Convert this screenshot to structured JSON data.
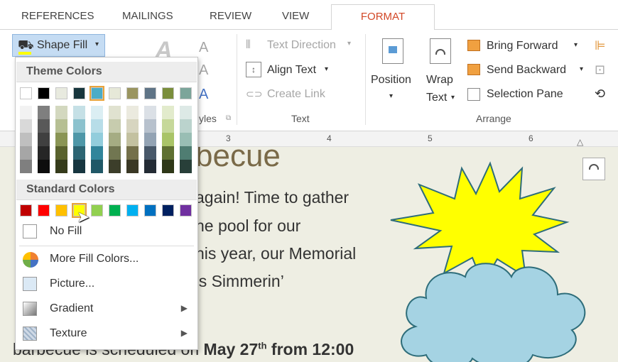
{
  "tabs": {
    "references": "REFERENCES",
    "mailings": "MAILINGS",
    "review": "REVIEW",
    "view": "VIEW",
    "format": "FORMAT"
  },
  "ribbon": {
    "shape_fill": "Shape Fill",
    "text_direction": "Text Direction",
    "align_text": "Align Text",
    "create_link": "Create Link",
    "text_group": "Text",
    "styles_group_partial": "yles",
    "position": "Position",
    "wrap": "Wrap",
    "wrap_text": "Text",
    "bring_forward": "Bring Forward",
    "send_backward": "Send Backward",
    "selection_pane": "Selection Pane",
    "arrange_group": "Arrange"
  },
  "ruler": {
    "marks": [
      "3",
      "4",
      "5",
      "6"
    ]
  },
  "dropdown": {
    "theme_header": "Theme Colors",
    "standard_header": "Standard Colors",
    "theme_top": [
      "#ffffff",
      "#000000",
      "#e8eadf",
      "#17363d",
      "#4bacc6",
      "#e6e8d8",
      "#9a9560",
      "#5f7486",
      "#7a8e3c",
      "#7ca59a"
    ],
    "theme_shades": [
      [
        "#f2f2f2",
        "#d9d9d9",
        "#bfbfbf",
        "#a6a6a6",
        "#7f7f7f"
      ],
      [
        "#7f7f7f",
        "#595959",
        "#404040",
        "#262626",
        "#0d0d0d"
      ],
      [
        "#d3d8bf",
        "#b6bf93",
        "#8a9555",
        "#59622d",
        "#353b1b"
      ],
      [
        "#c5e0e6",
        "#8cc2ce",
        "#4e97a8",
        "#2c6573",
        "#173640"
      ],
      [
        "#dbeef3",
        "#b7dde8",
        "#92cddc",
        "#31859b",
        "#205867"
      ],
      [
        "#e0e2d0",
        "#c7ccae",
        "#a5ac83",
        "#717651",
        "#3c3e2a"
      ],
      [
        "#ebeadf",
        "#d7d5c0",
        "#c3c1a0",
        "#74704a",
        "#3a3825"
      ],
      [
        "#dbe0e6",
        "#b7c1cd",
        "#93a3b4",
        "#48586a",
        "#242c35"
      ],
      [
        "#e2ebcc",
        "#c6d89a",
        "#a9c467",
        "#5e7031",
        "#2f3818"
      ],
      [
        "#dde9e6",
        "#bbd3cd",
        "#99beb4",
        "#4f7d72",
        "#283f39"
      ]
    ],
    "standard": [
      "#c00000",
      "#ff0000",
      "#ffc000",
      "#ffff00",
      "#92d050",
      "#00b050",
      "#00b0f0",
      "#0070c0",
      "#002060",
      "#7030a0"
    ],
    "no_fill": "No Fill",
    "more_fill_colors": "More Fill Colors...",
    "picture": "Picture...",
    "gradient": "Gradient",
    "texture": "Texture"
  },
  "document": {
    "title_partial": "becue",
    "line1": "again! Time to gather",
    "line2": "he pool for our",
    "line3": "his year, our Memorial",
    "line4": "’s Simmerin’",
    "line5_a": "barbecue is scheduled on ",
    "line5_b": "May 27",
    "line5_sup": "th",
    "line5_c": " from 12:00"
  },
  "colors": {
    "accent": "#d24726",
    "sun": "#ffff00",
    "cloud": "#a5d3e3"
  }
}
